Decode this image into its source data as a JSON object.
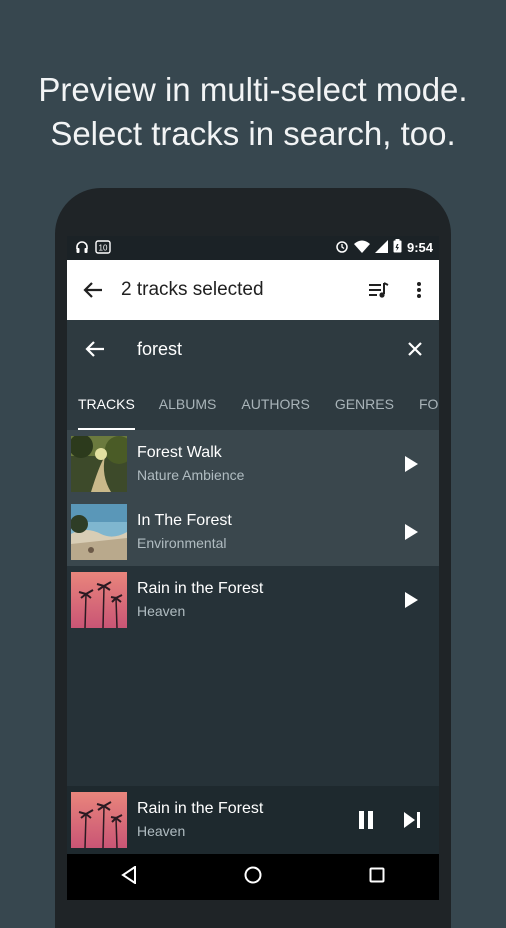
{
  "promo": {
    "line1": "Preview in multi-select mode.",
    "line2": "Select tracks in search, too."
  },
  "status": {
    "time": "9:54"
  },
  "selection_bar": {
    "title": "2 tracks selected"
  },
  "search": {
    "query": "forest"
  },
  "tabs": [
    {
      "label": "TRACKS",
      "active": true
    },
    {
      "label": "ALBUMS"
    },
    {
      "label": "AUTHORS"
    },
    {
      "label": "GENRES"
    },
    {
      "label": "FOL"
    }
  ],
  "tracks": [
    {
      "title": "Forest Walk",
      "artist": "Nature Ambience",
      "selected": true
    },
    {
      "title": "In The Forest",
      "artist": "Environmental",
      "selected": true
    },
    {
      "title": "Rain in the Forest",
      "artist": "Heaven",
      "selected": false
    }
  ],
  "now_playing": {
    "title": "Rain in the Forest",
    "artist": "Heaven"
  },
  "colors": {
    "background": "#37474f",
    "screen": "#263238",
    "selected_row": "#3a474d",
    "toolbar": "#2e3a40"
  }
}
